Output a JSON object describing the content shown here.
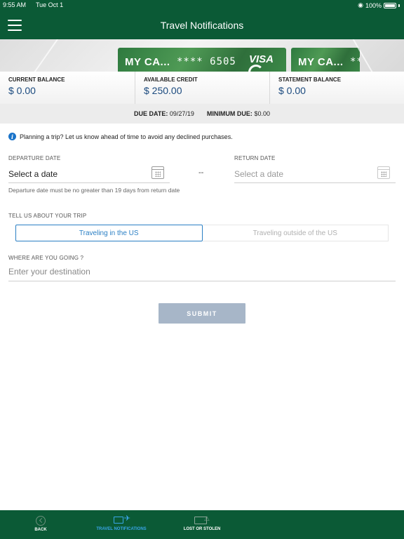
{
  "status_bar": {
    "time": "9:55 AM",
    "date": "Tue Oct 1",
    "battery": "100%"
  },
  "header": {
    "title": "Travel Notifications"
  },
  "cards": [
    {
      "name": "MY CA...",
      "masked_number": "**** 6505",
      "brand": "VISA"
    },
    {
      "name": "MY CA...",
      "masked_number": "**"
    }
  ],
  "balances": {
    "current_label": "CURRENT BALANCE",
    "current_value": "$ 0.00",
    "available_label": "AVAILABLE CREDIT",
    "available_value": "$ 250.00",
    "statement_label": "STATEMENT BALANCE",
    "statement_value": "$ 0.00"
  },
  "due": {
    "due_date_label": "DUE DATE:",
    "due_date_value": "09/27/19",
    "min_due_label": "MINIMUM DUE:",
    "min_due_value": "$0.00"
  },
  "info_text": "Planning a trip? Let us know ahead of time to avoid any declined purchases.",
  "form": {
    "departure_label": "DEPARTURE DATE",
    "departure_value": "Select a date",
    "return_label": "RETURN DATE",
    "return_placeholder": "Select a date",
    "separator": "--",
    "date_hint": "Departure date must be no greater than 19 days from return date",
    "trip_label": "TELL US ABOUT YOUR TRIP",
    "trip_options": [
      "Traveling in the US",
      "Traveling outside of the US"
    ],
    "trip_selected": "Traveling in the US",
    "destination_label": "WHERE ARE YOU GOING ?",
    "destination_placeholder": "Enter your destination",
    "submit_label": "SUBMIT"
  },
  "bottom_nav": [
    {
      "label": "BACK",
      "icon": "back-arrow-icon"
    },
    {
      "label": "TRAVEL NOTIFICATIONS",
      "icon": "card-plane-icon",
      "active": true
    },
    {
      "label": "LOST OR STOLEN",
      "icon": "card-warning-icon"
    }
  ],
  "colors": {
    "brand_green": "#0b5a36",
    "accent_blue": "#2a7fc4",
    "submit_disabled": "#a7b6c8"
  }
}
